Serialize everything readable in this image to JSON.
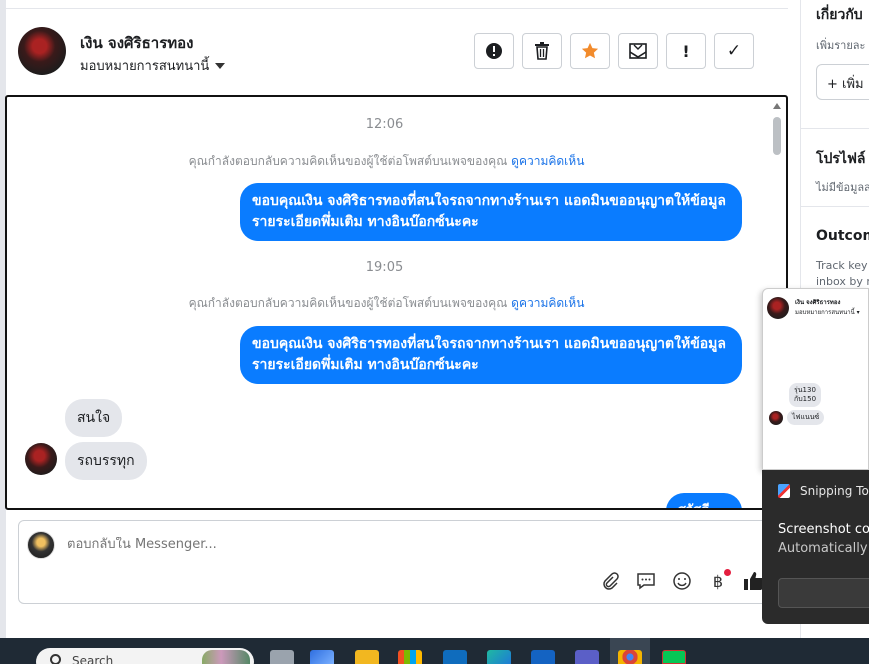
{
  "header": {
    "contact_name": "เงิน จงศิริธารทอง",
    "assign_label": "มอบหมายการสนทนานี้",
    "actions": [
      {
        "icon": "alert-circle-icon",
        "glyph": "!"
      },
      {
        "icon": "trash-icon",
        "glyph": "🗑"
      },
      {
        "icon": "star-icon",
        "glyph": "★"
      },
      {
        "icon": "mark-unread-icon",
        "glyph": "✉"
      },
      {
        "icon": "exclamation-icon",
        "glyph": "!"
      },
      {
        "icon": "check-icon",
        "glyph": "✓"
      }
    ]
  },
  "conversation": {
    "time_1": "12:06",
    "notice_1": "คุณกำลังตอบกลับความคิดเห็นของผู้ใช้ต่อโพสต์บนเพจของคุณ",
    "notice_link_1": "ดูความคิดเห็น",
    "outgoing_1": "ขอบคุณเงิน จงศิริธารทองที่สนใจรถจากทางร้านเรา แอดมินขออนุญาตให้ข้อมูลรายระเอียดพึ่มเติม ทางอินบ๊อกซ์นะคะ",
    "time_2": "19:05",
    "notice_2": "คุณกำลังตอบกลับความคิดเห็นของผู้ใช้ต่อโพสต์บนเพจของคุณ",
    "notice_link_2": "ดูความคิดเห็น",
    "outgoing_2": "ขอบคุณเงิน จงศิริธารทองที่สนใจรถจากทางร้านเรา แอดมินขออนุญาตให้ข้อมูลรายระเอียดพึ่มเติม ทางอินบ๊อกซ์นะคะ",
    "incoming_1": "สนใจ",
    "incoming_2": "รถบรรทุก",
    "outgoing_cut": "สวัสดี"
  },
  "composer": {
    "placeholder": "ตอบกลับใน Messenger...",
    "tools": [
      {
        "icon": "attachment-icon",
        "glyph": "📎"
      },
      {
        "icon": "saved-reply-icon",
        "glyph": "💬"
      },
      {
        "icon": "emoji-icon",
        "glyph": "☺"
      },
      {
        "icon": "baht-payment-icon",
        "glyph": "฿"
      },
      {
        "icon": "thumbs-up-icon",
        "glyph": "👍"
      }
    ]
  },
  "right_panel": {
    "about_title": "เกี่ยวกับ",
    "about_sub": "เพิ่มรายละ",
    "add_button": "+ เพิ่ม",
    "profile_title": "โปรไฟล์",
    "profile_sub": "ไม่มีข้อมูลส",
    "outcome_title": "Outcom",
    "outcome_sub_1": "Track key",
    "outcome_sub_2": "inbox by n"
  },
  "mini_popup": {
    "name": "เงิน จงศิริธารทอง",
    "sub": "มอบหมายการสนทนานี้ ▾",
    "bubble_1_line_1": "รุ่น130",
    "bubble_1_line_2": "กับ150",
    "bubble_2": "ไฟแนนซ์"
  },
  "toast": {
    "app": "Snipping Tool",
    "title": "Screenshot copied",
    "subtitle": "Automatically saved"
  },
  "taskbar": {
    "search_placeholder": "Search"
  }
}
